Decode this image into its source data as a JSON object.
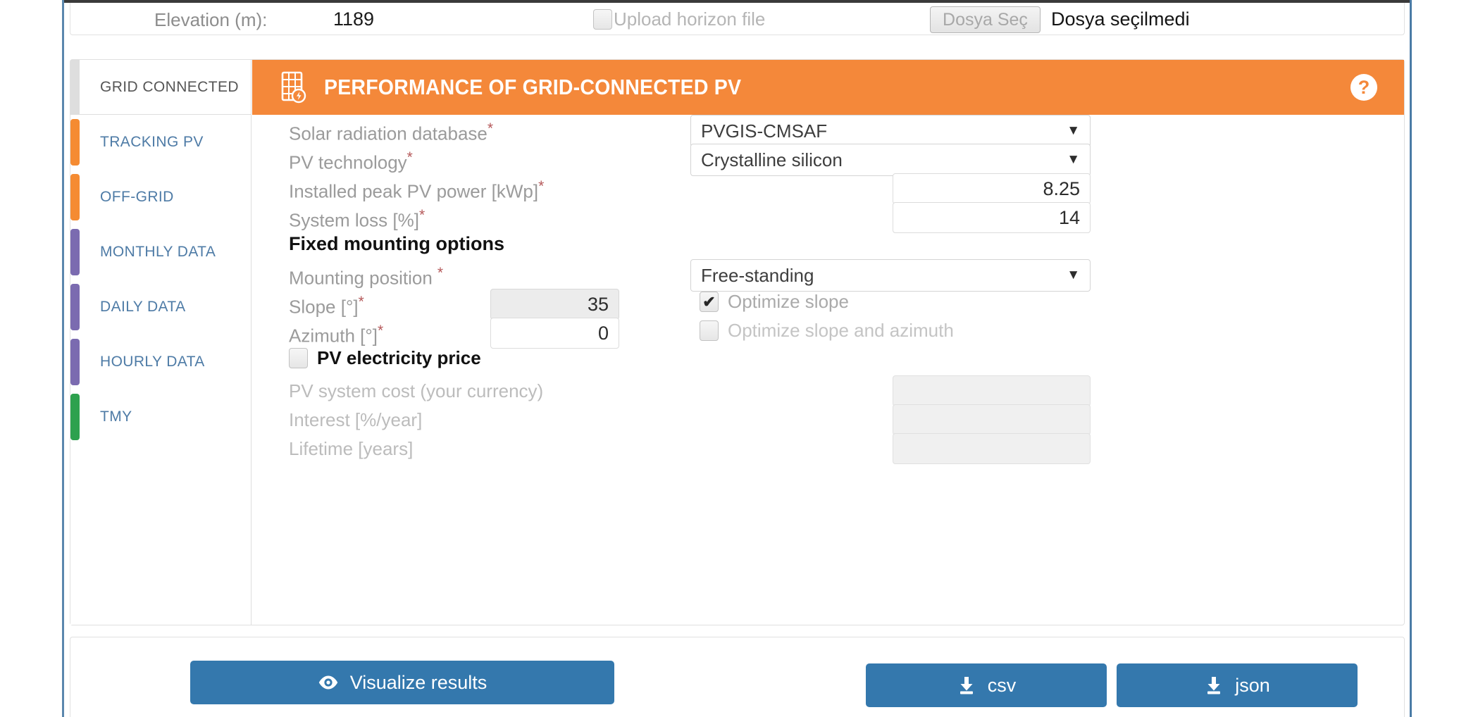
{
  "top_bar": {
    "elevation_label": "Elevation (m):",
    "elevation_value": "1189",
    "upload_horizon_label": "Upload horizon file",
    "upload_horizon_checked": false,
    "file_button_label": "Dosya Seç",
    "file_status": "Dosya seçilmedi"
  },
  "sidebar": {
    "items": [
      {
        "label": "GRID CONNECTED",
        "color": "#dedede",
        "active": true
      },
      {
        "label": "TRACKING PV",
        "color": "#f58b32",
        "active": false
      },
      {
        "label": "OFF-GRID",
        "color": "#f58b32",
        "active": false
      },
      {
        "label": "MONTHLY DATA",
        "color": "#7b6bb0",
        "active": false
      },
      {
        "label": "DAILY DATA",
        "color": "#7b6bb0",
        "active": false
      },
      {
        "label": "HOURLY DATA",
        "color": "#7b6bb0",
        "active": false
      },
      {
        "label": "TMY",
        "color": "#2da14e",
        "active": false
      }
    ]
  },
  "panel": {
    "title": "PERFORMANCE OF GRID-CONNECTED PV",
    "header_color": "#f4883a",
    "help_label": "?",
    "solar_db": {
      "label": "Solar radiation database",
      "required": true,
      "value": "PVGIS-CMSAF"
    },
    "pv_tech": {
      "label": "PV technology",
      "required": true,
      "value": "Crystalline silicon"
    },
    "peak_power": {
      "label": "Installed peak PV power [kWp]",
      "required": true,
      "value": "8.25"
    },
    "system_loss": {
      "label": "System loss [%]",
      "required": true,
      "value": "14"
    },
    "fixed_mounting_heading": "Fixed mounting options",
    "mounting_position": {
      "label": "Mounting position",
      "required": true,
      "value": "Free-standing"
    },
    "slope": {
      "label": "Slope [°]",
      "required": true,
      "value": "35",
      "disabled": true
    },
    "azimuth": {
      "label": "Azimuth [°]",
      "required": true,
      "value": "0",
      "disabled": false
    },
    "optimize_slope": {
      "label": "Optimize slope",
      "checked": true
    },
    "optimize_slope_azimuth": {
      "label": "Optimize slope and azimuth",
      "checked": false
    },
    "pv_price": {
      "label": "PV electricity price",
      "checked": false
    },
    "system_cost": {
      "label": "PV system cost (your currency)",
      "value": ""
    },
    "interest": {
      "label": "Interest [%/year]",
      "value": ""
    },
    "lifetime": {
      "label": "Lifetime [years]",
      "value": ""
    }
  },
  "actions": {
    "visualize_label": "Visualize results",
    "csv_label": "csv",
    "json_label": "json",
    "button_color": "#3478ad"
  }
}
